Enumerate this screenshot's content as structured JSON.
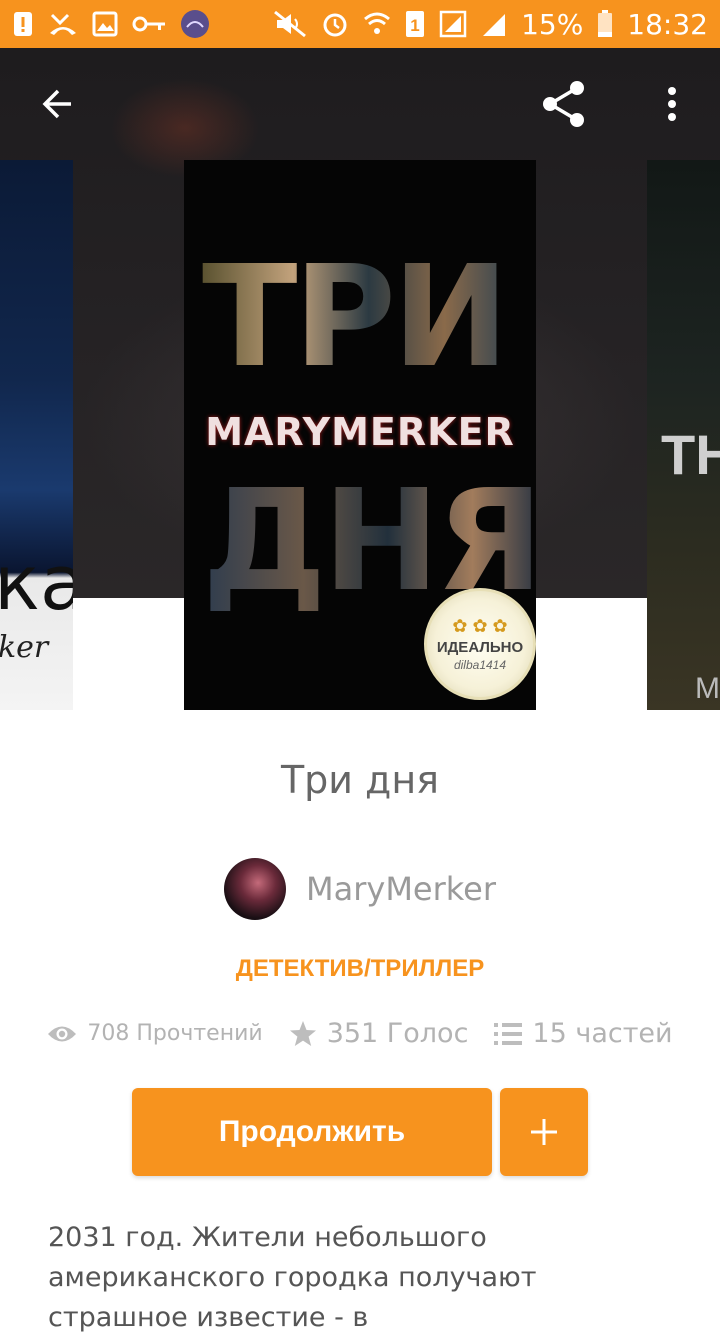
{
  "status_bar": {
    "battery_percent": "15%",
    "time": "18:32",
    "sim_label": "1",
    "left_icons": [
      "alert-icon",
      "missed-call-icon",
      "image-icon",
      "key-icon",
      "app-avatar-icon"
    ],
    "right_icons": [
      "mute-icon",
      "alarm-icon",
      "wifi-icon",
      "sim-icon",
      "signal-icon",
      "signal-icon-2",
      "battery-icon"
    ]
  },
  "toolbar": {
    "back_icon": "arrow-back-icon",
    "share_icon": "share-icon",
    "menu_icon": "more-vert-icon"
  },
  "covers": {
    "main": {
      "top_word": "ТРИ",
      "author_text": "MARYMERKER",
      "bottom_word": "ДНЯ",
      "seal_text": "ИДЕАЛЬНО",
      "seal_sub": "dilba1414"
    },
    "left": {
      "word": "ка",
      "sub": "ker"
    },
    "right": {
      "word": "TH",
      "sub": "M"
    }
  },
  "story": {
    "title": "Три дня",
    "author": "MaryMerker",
    "genre": "ДЕТЕКТИВ/ТРИЛЛЕР",
    "reads": "708 Прочтений",
    "votes": "351 Голос",
    "parts": "15 частей",
    "continue_label": "Продолжить",
    "add_label": "+",
    "description": "2031 год. Жители небольшого американского городка получают страшное известие - в"
  },
  "colors": {
    "accent": "#f7931e",
    "header_bg": "#231f20",
    "text_muted": "#b3b3b3"
  }
}
